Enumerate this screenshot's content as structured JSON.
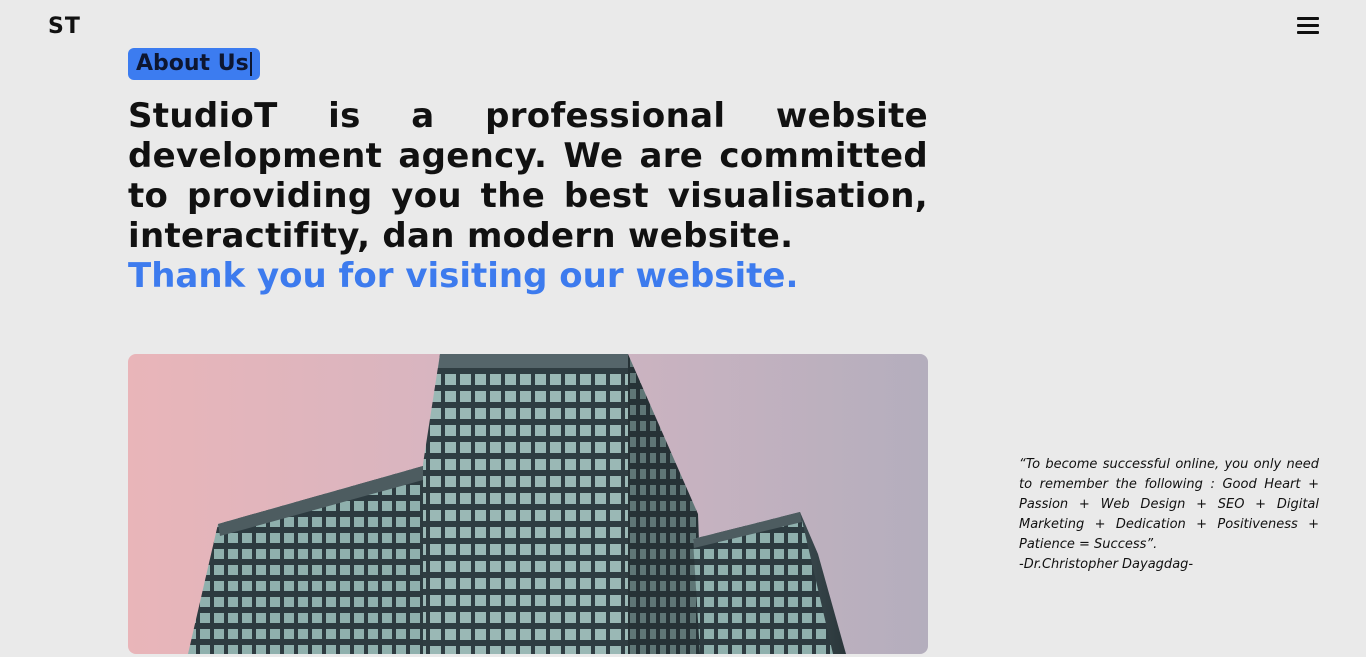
{
  "header": {
    "logo": "ST",
    "menu_icon": "hamburger-menu-icon"
  },
  "about": {
    "badge_label": "About Us",
    "headline": "StudioT is a professional website development agency. We are committed to providing you the best visualisation, interactifity, dan modern website.",
    "thanks": "Thank you for visiting our website."
  },
  "hero": {
    "image": "office-building-photo"
  },
  "quote": {
    "text": "“To become successful online, you only need to remember the following : Good Heart + Passion + Web Design + SEO + Digital Marketing + Dedication + Positiveness + Patience = Success”.",
    "author": "-Dr.Christopher Dayagdag-"
  },
  "colors": {
    "background": "#eaeaea",
    "accent": "#3d7bee",
    "text": "#111111"
  }
}
